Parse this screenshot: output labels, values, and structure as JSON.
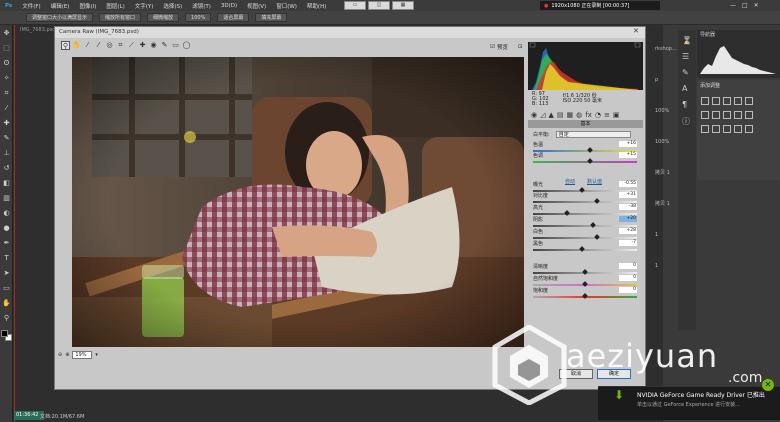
{
  "ps": {
    "menu": [
      "文件(F)",
      "编辑(E)",
      "图像(I)",
      "图层(L)",
      "文字(Y)",
      "选择(S)",
      "滤镜(T)",
      "3D(D)",
      "视图(V)",
      "窗口(W)",
      "帮助(H)"
    ],
    "options": [
      "调整窗口大小以满屏显示",
      "缩放所有窗口",
      "细微缩放",
      "100%",
      "适合屏幕",
      "填充屏幕"
    ],
    "recording": "1920x1080  正在录制 [00:00:37]",
    "doc_tab": "IMG_7683.psd",
    "status": "文档:20.1M/67.6M",
    "time": "01:36:42",
    "side_labels": [
      "rkshop...",
      "p",
      "100%",
      "100%",
      "拷贝 1",
      "拷贝 1",
      "1",
      "1"
    ],
    "adjust_title": "添加调整",
    "nav_title": "导航器"
  },
  "cr": {
    "title": "Camera Raw (IMG_7683.psd)",
    "preview_label": "预览",
    "zoom": "19%",
    "readout": {
      "r": "R: 97",
      "g": "G: 102",
      "b": "B: 113",
      "exposure": "f/1.6    1/320 秒",
      "iso": "ISO 220   50 毫米"
    },
    "panel_title": "基本",
    "wb_label": "白平衡:",
    "wb_value": "自定",
    "auto": "自动",
    "default": "默认值",
    "sliders": [
      {
        "label": "色温",
        "value": "+16",
        "pos": 0.55,
        "track": "temp"
      },
      {
        "label": "色调",
        "value": "+15",
        "pos": 0.55,
        "track": "tint"
      },
      {
        "label": "曝光",
        "value": "-0.55",
        "pos": 0.47,
        "track": "gray"
      },
      {
        "label": "对比度",
        "value": "+31",
        "pos": 0.62,
        "track": "gray"
      },
      {
        "label": "高光",
        "value": "-38",
        "pos": 0.33,
        "track": "gray"
      },
      {
        "label": "阴影",
        "value": "+20",
        "pos": 0.58,
        "track": "gray",
        "selected": true
      },
      {
        "label": "白色",
        "value": "+28",
        "pos": 0.62,
        "track": "gray"
      },
      {
        "label": "黑色",
        "value": "-7",
        "pos": 0.47,
        "track": "gray"
      },
      {
        "label": "清晰度",
        "value": "0",
        "pos": 0.5,
        "track": "gray"
      },
      {
        "label": "自然饱和度",
        "value": "0",
        "pos": 0.5,
        "track": "vib"
      },
      {
        "label": "饱和度",
        "value": "0",
        "pos": 0.5,
        "track": "sat"
      }
    ],
    "cancel": "取消",
    "ok": "确定"
  },
  "watermark": {
    "text": "aeziyuan",
    "com": ".com"
  },
  "nvidia": {
    "title": "NVIDIA GeForce Game Ready Driver 已推出",
    "sub": "单击以通过 GeForce Experience 进行安装..."
  },
  "colors": {
    "ps_bg": "#262626",
    "cr_bg": "#c8c8c8",
    "accent": "#76b900",
    "record_red": "#b0281e"
  }
}
